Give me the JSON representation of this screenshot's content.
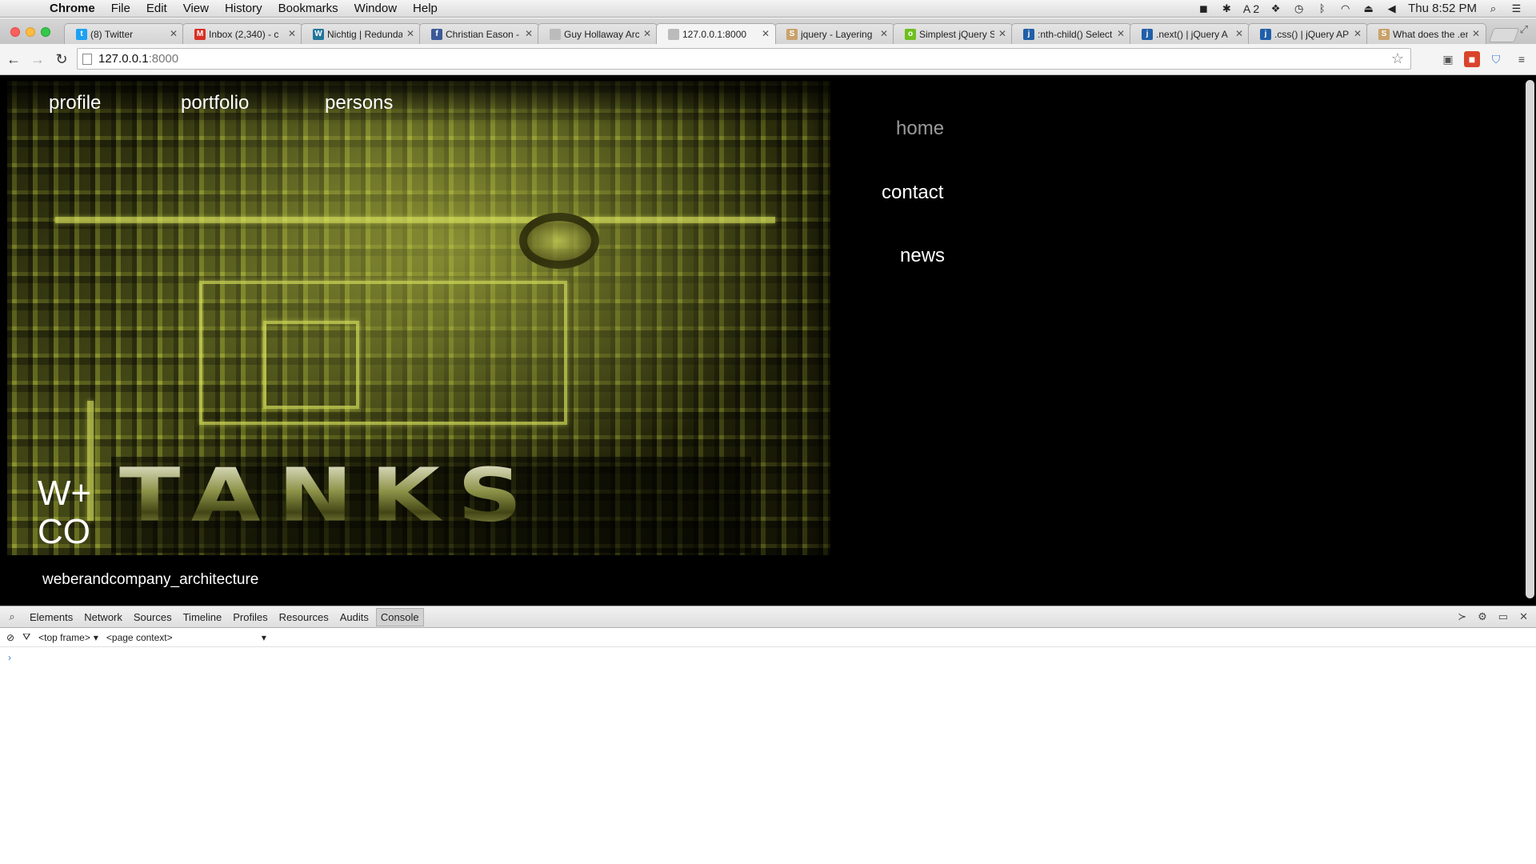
{
  "menubar": {
    "app_name": "Chrome",
    "menus": [
      "File",
      "Edit",
      "View",
      "History",
      "Bookmarks",
      "Window",
      "Help"
    ],
    "status_count": "2",
    "clock": "Thu 8:52 PM"
  },
  "tabs": [
    {
      "title": "(8) Twitter",
      "icon_color": "#1da1f2",
      "icon_glyph": "t"
    },
    {
      "title": "Inbox (2,340) - c",
      "icon_color": "#d93025",
      "icon_glyph": "M"
    },
    {
      "title": "Nichtig | Redunda",
      "icon_color": "#21759b",
      "icon_glyph": "W"
    },
    {
      "title": "Christian Eason -",
      "icon_color": "#3b5998",
      "icon_glyph": "f"
    },
    {
      "title": "Guy Hollaway Arc",
      "icon_color": "#bbbbbb",
      "icon_glyph": ""
    },
    {
      "title": "127.0.0.1:8000",
      "icon_color": "#bbbbbb",
      "icon_glyph": "",
      "active": true
    },
    {
      "title": "jquery - Layering",
      "icon_color": "#c9a26a",
      "icon_glyph": "S"
    },
    {
      "title": "Simplest jQuery S",
      "icon_color": "#6fbf1e",
      "icon_glyph": "o"
    },
    {
      "title": ":nth-child() Select",
      "icon_color": "#1f5fa8",
      "icon_glyph": "j"
    },
    {
      "title": ".next() | jQuery A",
      "icon_color": "#1f5fa8",
      "icon_glyph": "j"
    },
    {
      "title": ".css() | jQuery API",
      "icon_color": "#1f5fa8",
      "icon_glyph": "j"
    },
    {
      "title": "What does the .en",
      "icon_color": "#c9a26a",
      "icon_glyph": "S"
    }
  ],
  "toolbar": {
    "url_host": "127.0.0.1",
    "url_port": ":8000"
  },
  "site": {
    "top_nav": [
      "profile",
      "portfolio",
      "persons"
    ],
    "side_nav": [
      "home",
      "contact",
      "news"
    ],
    "logo_word": "TANKS",
    "wco_line1": "W+",
    "wco_line2": "CO",
    "tagline": "weberandcompany_architecture",
    "colors": {
      "background": "#000000",
      "nav_text": "#ffffff",
      "home_text": "#9a9a9a",
      "hero_tint": "#7c8428"
    }
  },
  "devtools": {
    "tabs": [
      "Elements",
      "Network",
      "Sources",
      "Timeline",
      "Profiles",
      "Resources",
      "Audits",
      "Console"
    ],
    "active_tab": "Console",
    "frame_select": "<top frame>",
    "context_select": "<page context>",
    "prompt": "›"
  }
}
